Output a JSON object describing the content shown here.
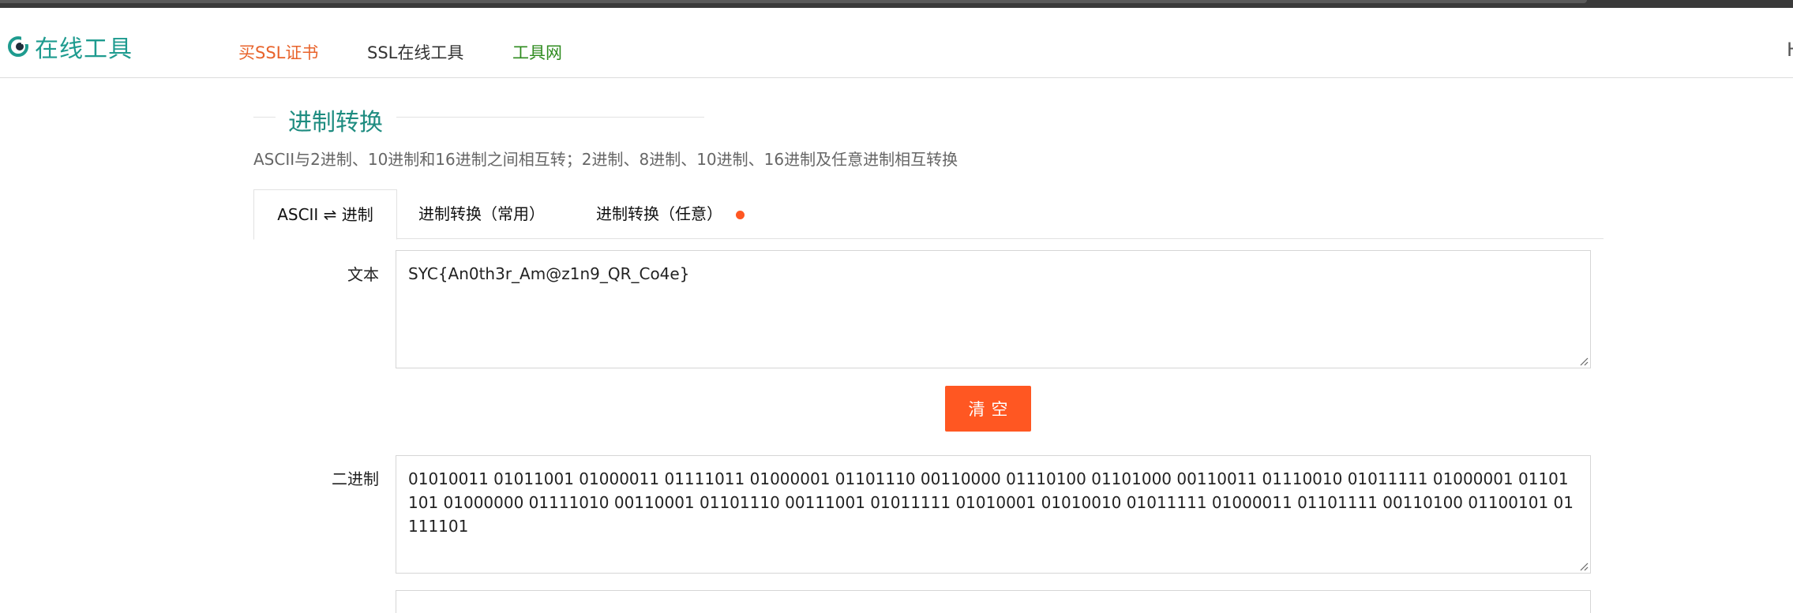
{
  "header": {
    "logo_text": "在线工具",
    "nav": {
      "buy_ssl": "买SSL证书",
      "ssl_tools": "SSL在线工具",
      "tools_net": "工具网"
    },
    "right_cut_text": "H"
  },
  "section": {
    "title": "进制转换",
    "subtitle": "ASCII与2进制、10进制和16进制之间相互转；2进制、8进制、10进制、16进制及任意进制相互转换"
  },
  "tabs": [
    {
      "label": "ASCII ⇌ 进制",
      "active": true
    },
    {
      "label": "进制转换（常用）",
      "active": false
    },
    {
      "label": "进制转换（任意）",
      "active": false
    }
  ],
  "form": {
    "text_label": "文本",
    "text_value": "SYC{An0th3r_Am@z1n9_QR_Co4e}",
    "clear_button": "清空",
    "binary_label": "二进制",
    "binary_value": "01010011 01011001 01000011 01111011 01000001 01101110 00110000 01110100 01101000 00110011 01110010 01011111 01000001 01101101 01000000 01111010 00110001 01101110 00111001 01011111 01010001 01010010 01011111 01000011 01101111 00110100 01100101 01111101"
  },
  "colors": {
    "brand": "#1e9b8f",
    "accent": "#ff5722",
    "nav_buy": "#e8632b",
    "nav_tools": "#2e8b1e"
  },
  "icons": {
    "logo": "eye-logo-icon",
    "tab_badge": "notification-dot-icon",
    "resize": "resize-grip-icon"
  }
}
